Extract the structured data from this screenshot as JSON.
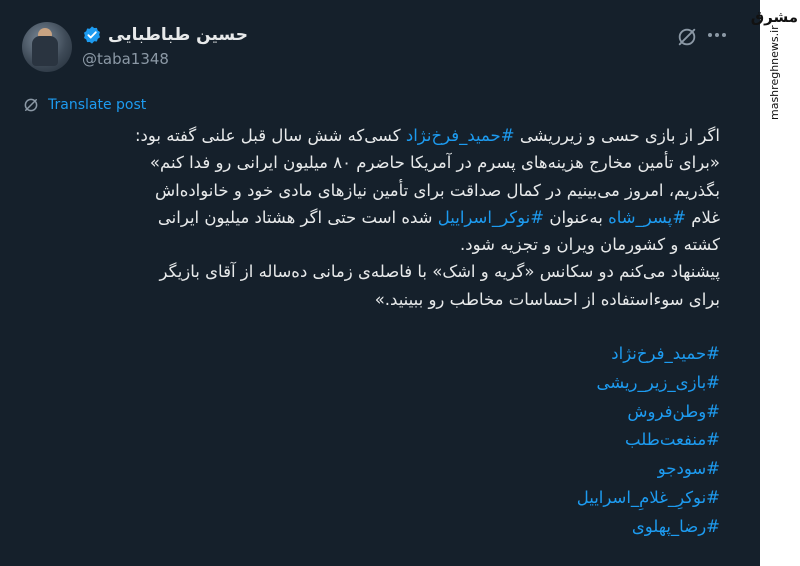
{
  "author": {
    "display_name": "حسین طباطبایی",
    "handle": "@taba1348"
  },
  "translate_label": "Translate post",
  "body_lines": [
    {
      "segments": [
        {
          "t": "اگر از بازی حسی و زیرریشی ",
          "tag": false
        },
        {
          "t": "#حمید_فرخ‌نژاد",
          "tag": true
        },
        {
          "t": " کسی‌که شش سال قبل علنی گفته بود:",
          "tag": false
        }
      ]
    },
    {
      "segments": [
        {
          "t": "«برای تأمین مخارج هزینه‌های پسرم در آمریکا حاضرم ۸۰ میلیون ایرانی رو فدا کنم»",
          "tag": false
        }
      ]
    },
    {
      "segments": [
        {
          "t": "بگذریم، امروز می‌بینیم در کمال صداقت برای تأمین نیازهای مادی خود و خانواده‌اش",
          "tag": false
        }
      ]
    },
    {
      "segments": [
        {
          "t": "غلام ",
          "tag": false
        },
        {
          "t": "#پسر_شاه",
          "tag": true
        },
        {
          "t": " به‌عنوان ",
          "tag": false
        },
        {
          "t": "#نوکر_اسراییل",
          "tag": true
        },
        {
          "t": " شده است حتی اگر هشتاد میلیون ایرانی",
          "tag": false
        }
      ]
    },
    {
      "segments": [
        {
          "t": "کشته و کشورمان ویران و تجزیه شود.",
          "tag": false
        }
      ]
    },
    {
      "segments": [
        {
          "t": "پیشنهاد می‌کنم دو سکانس «گریه و اشک» با فاصله‌ی زمانی ده‌ساله از آقای بازیگر",
          "tag": false
        }
      ]
    },
    {
      "segments": [
        {
          "t": "برای سوءاستفاده از احساسات مخاطب رو ببینید.»",
          "tag": false
        }
      ]
    }
  ],
  "hashtags": [
    "#حمید_فرخ‌نژاد",
    "#بازی_زیر_ریشی",
    "#وطن‌فروش",
    "#منفعت‌طلب",
    "#سودجو",
    "#نوکرِ_غلامِ_اسراییل",
    "#رضا_پهلوی"
  ],
  "watermark": {
    "logo_text": "مشرق",
    "url": "mashreghnews.ir"
  },
  "icons": {
    "verified": "verified-badge-icon",
    "grok": "grok-icon",
    "more": "more-options-icon",
    "translate": "translate-icon"
  },
  "colors": {
    "background": "#15202b",
    "accent": "#1d9bf0",
    "text": "#e7e9ea",
    "muted": "#8b98a5"
  }
}
